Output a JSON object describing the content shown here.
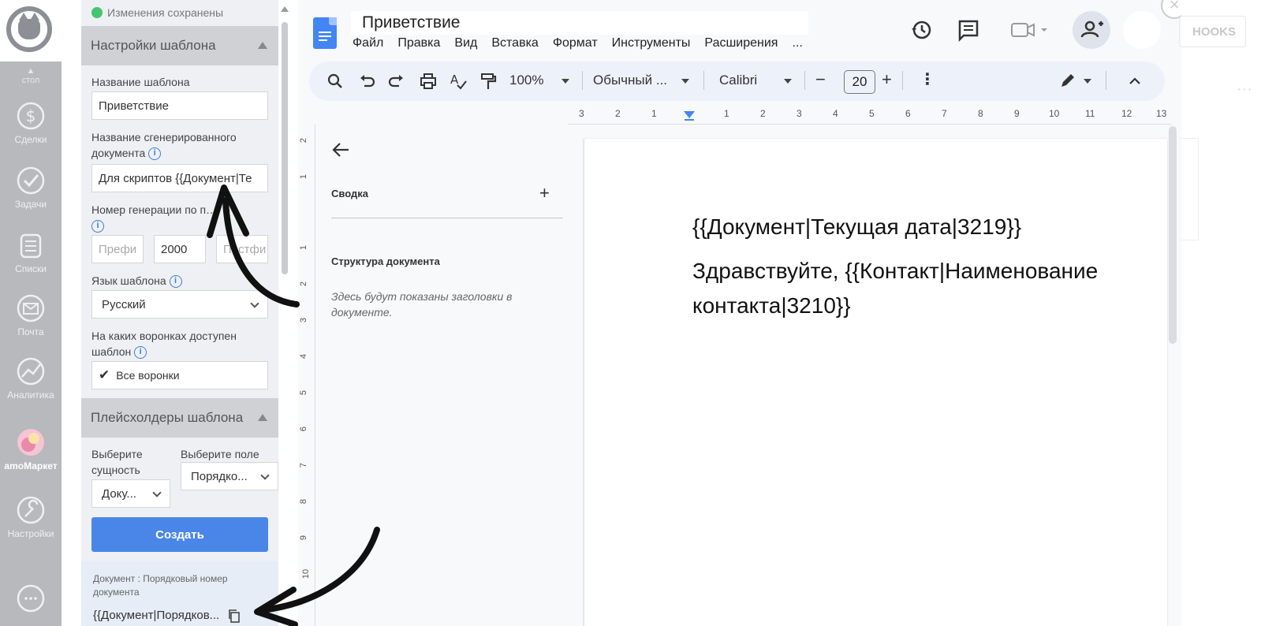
{
  "amo_nav": {
    "up_label": "стол",
    "items": [
      {
        "label": "Сделки",
        "icon": "deals-icon"
      },
      {
        "label": "Задачи",
        "icon": "tasks-icon"
      },
      {
        "label": "Списки",
        "icon": "lists-icon"
      },
      {
        "label": "Почта",
        "icon": "mail-icon"
      },
      {
        "label": "Аналитика",
        "icon": "analytics-icon"
      },
      {
        "label": "amoМаркет",
        "icon": "market-icon"
      },
      {
        "label": "Настройки",
        "icon": "settings-icon"
      }
    ]
  },
  "panel": {
    "saved_status": "Изменения сохранены",
    "settings_section": "Настройки шаблона",
    "template_name_label": "Название шаблона",
    "template_name_value": "Приветствие",
    "generated_name_label_1": "Название сгенерированного",
    "generated_name_label_2": "документа",
    "generated_name_value": "Для скриптов {{Документ|Те",
    "gen_number_label": "Номер генерации по п…",
    "prefix_placeholder": "Префи",
    "number_value": "2000",
    "postfix_placeholder": "Постфи",
    "language_label": "Язык шаблона",
    "language_value": "Русский",
    "funnels_label_1": "На каких воронках доступен",
    "funnels_label_2": "шаблон",
    "funnels_value": "Все воронки",
    "placeholders_section": "Плейсхолдеры шаблона",
    "entity_label_1": "Выберите",
    "entity_label_2": "сущность",
    "entity_value": "Доку...",
    "field_label": "Выберите поле",
    "field_value": "Порядко...",
    "create_button": "Создать",
    "placeholder_desc": "Документ : Порядковый номер документа",
    "placeholder_code": "{{Документ|Порядков..."
  },
  "gdocs": {
    "title": "Приветствие",
    "menu": [
      "Файл",
      "Правка",
      "Вид",
      "Вставка",
      "Формат",
      "Инструменты",
      "Расширения",
      "..."
    ],
    "zoom": "100%",
    "style": "Обычный ...",
    "font": "Calibri",
    "font_size": "20",
    "ruler_marks": [
      "3",
      "2",
      "1",
      "1",
      "2",
      "3",
      "4",
      "5",
      "6",
      "7",
      "8",
      "9",
      "10",
      "11",
      "12",
      "13"
    ],
    "vruler_marks": [
      "2",
      "1",
      "1",
      "2",
      "3",
      "4",
      "5",
      "6",
      "7",
      "8",
      "9",
      "10"
    ],
    "outline": {
      "summary_label": "Сводка",
      "structure_label": "Структура документа",
      "empty_hint": "Здесь будут показаны заголовки в документе."
    },
    "doc_lines": [
      "{{Документ|Текущая дата|3219}}",
      "Здравствуйте, {{Контакт|Наименование",
      "контакта|3210}}"
    ]
  },
  "background": {
    "hooks_label": "HOOKS"
  },
  "colors": {
    "accent": "#4a86e8",
    "saved_dot": "#46c46e",
    "nav_bg": "#b7b9bc"
  }
}
